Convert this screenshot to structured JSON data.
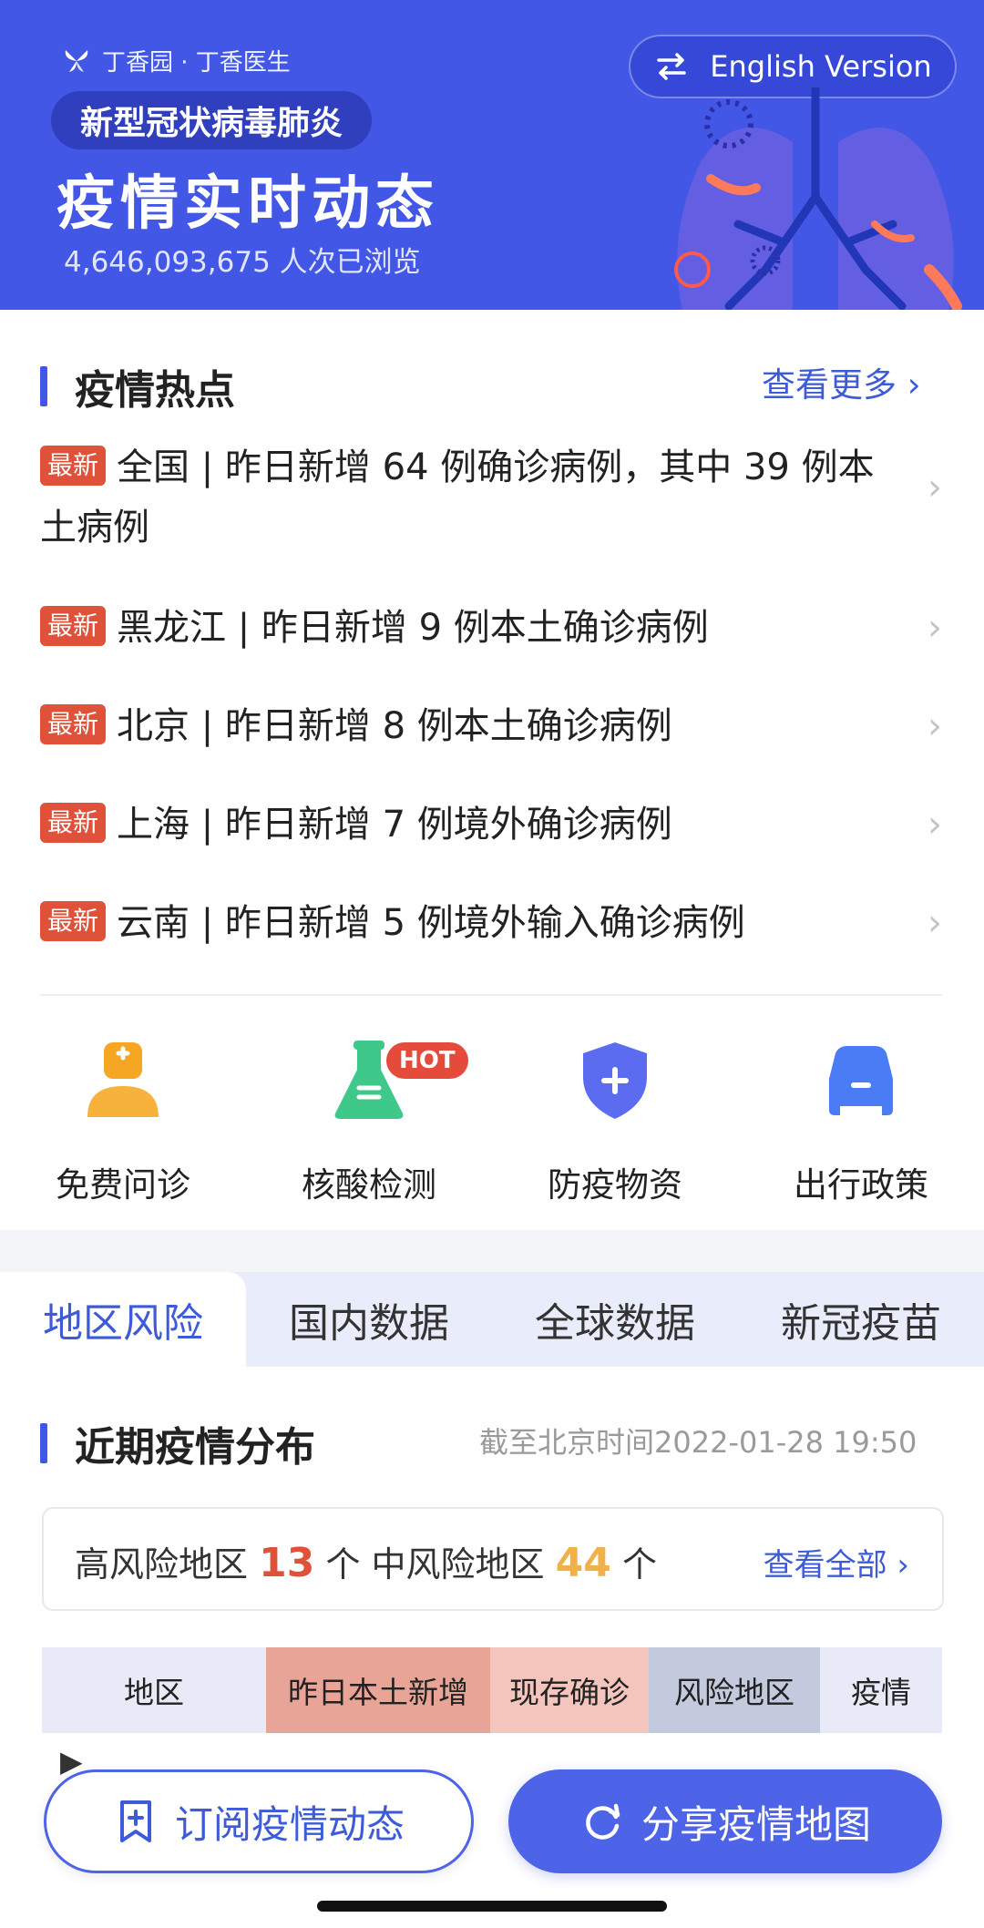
{
  "banner": {
    "brand": "丁香园 · 丁香医生",
    "english_button": "English Version",
    "pill": "新型冠状病毒肺炎",
    "title": "疫情实时动态",
    "views": "4,646,093,675 人次已浏览"
  },
  "hot": {
    "title": "疫情热点",
    "more": "查看更多",
    "tag": "最新",
    "items": [
      {
        "text": "全国 | 昨日新增 64 例确诊病例，其中 39 例本土病例"
      },
      {
        "text": "黑龙江 | 昨日新增 9 例本土确诊病例"
      },
      {
        "text": "北京 | 昨日新增 8 例本土确诊病例"
      },
      {
        "text": "上海 | 昨日新增 7 例境外确诊病例"
      },
      {
        "text": "云南 | 昨日新增 5 例境外输入确诊病例"
      }
    ]
  },
  "services": [
    {
      "label": "免费问诊",
      "icon": "doctor-icon",
      "color": "#f5a623"
    },
    {
      "label": "核酸检测",
      "icon": "test-flask-icon",
      "color": "#3ec98a",
      "badge": "HOT"
    },
    {
      "label": "防疫物资",
      "icon": "shield-plus-icon",
      "color": "#5b6cf0"
    },
    {
      "label": "出行政策",
      "icon": "car-icon",
      "color": "#4a7cf5"
    }
  ],
  "tabs": [
    "地区风险",
    "国内数据",
    "全球数据",
    "新冠疫苗"
  ],
  "distribution": {
    "title": "近期疫情分布",
    "timestamp": "截至北京时间2022-01-28 19:50",
    "high_label": "高风险地区",
    "high_count": "13",
    "unit": "个",
    "mid_label": "中风险地区",
    "mid_count": "44",
    "see_all": "查看全部"
  },
  "table": {
    "headers": [
      "地区",
      "昨日本土新增",
      "现存确诊",
      "风险地区",
      "疫情"
    ],
    "header_colors": [
      "#e8ebf7",
      "#e8a597",
      "#f3c5bc",
      "#c3cade",
      "#e8ebf7"
    ]
  },
  "actions": {
    "subscribe": "订阅疫情动态",
    "share": "分享疫情地图"
  },
  "colors": {
    "brand_blue": "#4357e6",
    "accent_red": "#e0513a",
    "accent_orange": "#f0b04a"
  }
}
